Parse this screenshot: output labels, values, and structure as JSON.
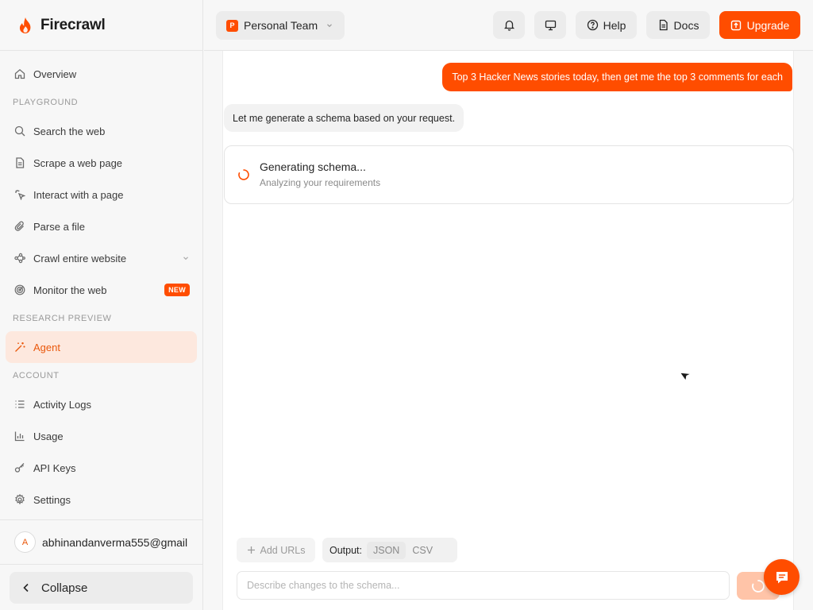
{
  "brand": {
    "name": "Firecrawl",
    "icon": "flame-icon",
    "accent": "#ff4d00"
  },
  "sidebar": {
    "overview": {
      "label": "Overview",
      "icon": "home-icon"
    },
    "sections": {
      "playground": "PLAYGROUND",
      "research": "RESEARCH PREVIEW",
      "account": "ACCOUNT"
    },
    "playground_items": [
      {
        "label": "Search the web",
        "icon": "search-icon"
      },
      {
        "label": "Scrape a web page",
        "icon": "document-icon"
      },
      {
        "label": "Interact with a page",
        "icon": "pointer-click-icon"
      },
      {
        "label": "Parse a file",
        "icon": "paperclip-icon"
      },
      {
        "label": "Crawl entire website",
        "icon": "network-icon"
      },
      {
        "label": "Monitor the web",
        "icon": "radar-icon",
        "badge": "NEW"
      }
    ],
    "agent": {
      "label": "Agent",
      "icon": "magic-wand-icon",
      "active": true
    },
    "account_items": [
      {
        "label": "Activity Logs",
        "icon": "list-icon"
      },
      {
        "label": "Usage",
        "icon": "bar-chart-icon"
      },
      {
        "label": "API Keys",
        "icon": "key-icon"
      },
      {
        "label": "Settings",
        "icon": "gear-icon"
      }
    ],
    "user": {
      "avatar_letter": "A",
      "email": "abhinandanverma555@gmail"
    },
    "collapse_label": "Collapse"
  },
  "topbar": {
    "team": {
      "logo_letter": "P",
      "name": "Personal Team"
    },
    "help_label": "Help",
    "docs_label": "Docs",
    "upgrade_label": "Upgrade"
  },
  "chat": {
    "user_message": "Top 3 Hacker News stories today, then get me the top 3 comments for each",
    "assistant_message": "Let me generate a schema based on your request.",
    "status": {
      "title": "Generating schema...",
      "subtitle": "Analyzing your requirements"
    },
    "add_urls_label": "Add URLs",
    "output": {
      "label": "Output:",
      "options": [
        "JSON",
        "CSV"
      ],
      "selected": "JSON"
    },
    "input_placeholder": "Describe changes to the schema..."
  }
}
